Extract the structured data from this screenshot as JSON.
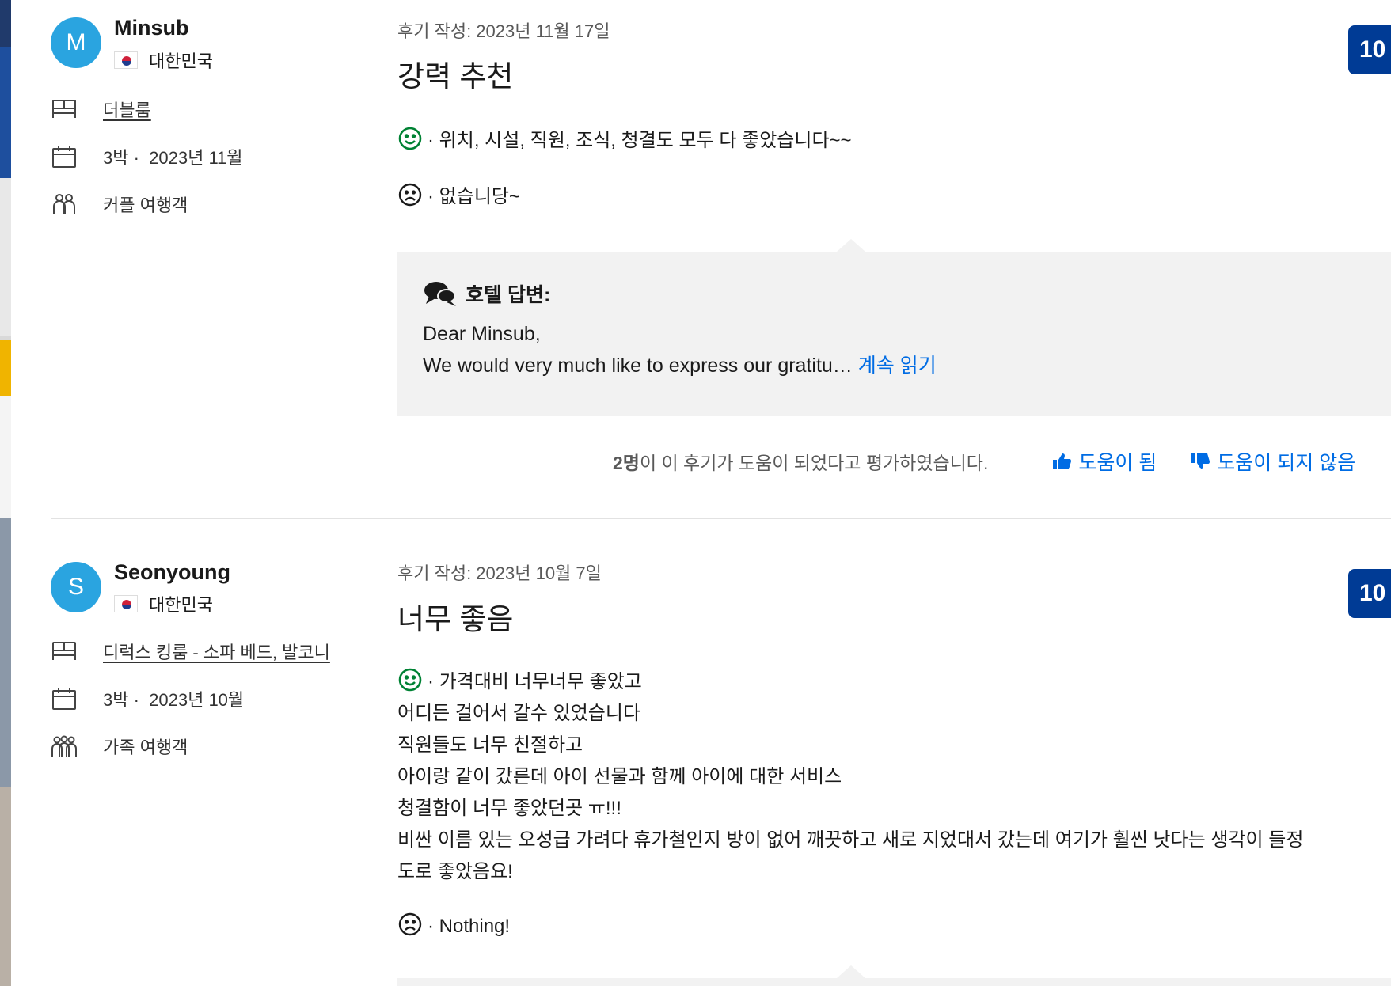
{
  "reviews": [
    {
      "avatar_letter": "M",
      "name": "Minsub",
      "country": "대한민국",
      "room": "더블룸",
      "stay_nights": "3박 ·",
      "stay_month": "2023년 11월",
      "traveler_type": "커플 여행객",
      "date": "후기 작성: 2023년 11월 17일",
      "title": "강력 추천",
      "score": "10",
      "pro": "· 위치, 시설, 직원, 조식, 청결도 모두 다 좋았습니다~~",
      "con": "· 없습니당~",
      "response": {
        "title": "호텔 답변:",
        "line1": "Dear Minsub,",
        "line2": "We would very much like to express our gratitu…",
        "read_more": "계속 읽기"
      },
      "helpful": {
        "count": "2명",
        "text": "이 이 후기가 도움이 되었다고 평가하였습니다.",
        "helpful_label": "도움이 됨",
        "not_helpful_label": "도움이 되지 않음"
      }
    },
    {
      "avatar_letter": "S",
      "name": "Seonyoung",
      "country": "대한민국",
      "room": "디럭스 킹룸 - 소파 베드, 발코니",
      "stay_nights": "3박 ·",
      "stay_month": "2023년 10월",
      "traveler_type": "가족 여행객",
      "date": "후기 작성: 2023년 10월 7일",
      "title": "너무 좋음",
      "score": "10",
      "pro": "· 가격대비 너무너무 좋았고\n어디든 걸어서 갈수 있었습니다\n직원들도 너무 친절하고\n아이랑 같이 갔른데 아이 선물과 함께 아이에 대한 서비스\n청결함이 너무 좋았던곳 ㅠ!!!\n비싼 이름 있는 오성급 가려다 휴가철인지 방이 없어 깨끗하고 새로 지었대서 갔는데 여기가 훨씬 낫다는 생각이 들정\n도로 좋았음요!",
      "con": "· Nothing!"
    }
  ],
  "colors": {
    "avatar": "#2aa4e0",
    "score_badge": "#003b95",
    "link": "#006ce4",
    "positive_face": "#008234",
    "response_bg": "#f2f2f2"
  },
  "icons": [
    "bed-icon",
    "calendar-icon",
    "people-icon",
    "smile-icon",
    "frown-icon",
    "speech-bubbles-icon",
    "thumbs-up-icon",
    "thumbs-down-icon"
  ]
}
